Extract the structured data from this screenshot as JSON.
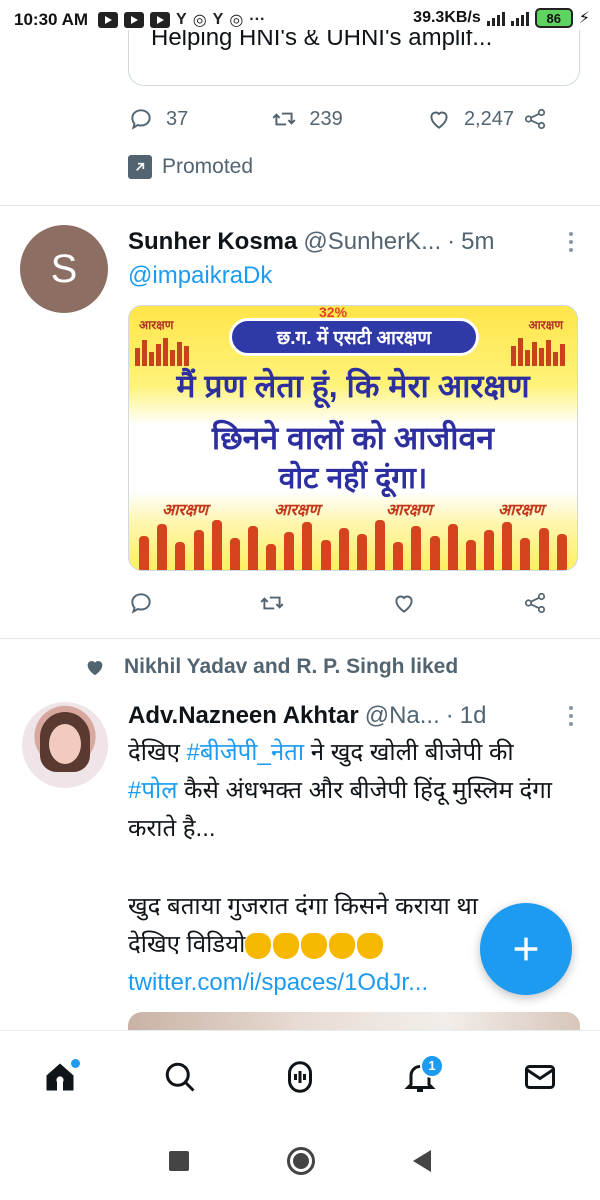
{
  "status_bar": {
    "time": "10:30 AM",
    "net_speed": "39.3KB/s",
    "battery": "86"
  },
  "promo_tweet": {
    "card_text": "Helping HNI's & UHNI's amplif...",
    "reply_count": "37",
    "retweet_count": "239",
    "like_count": "2,247",
    "promoted_label": "Promoted"
  },
  "tweet1": {
    "avatar_letter": "S",
    "name": "Sunher Kosma",
    "handle": "@SunherK...",
    "dot": "·",
    "time": "5m",
    "mention": "@impaikraDk",
    "banner": {
      "top_tag": "32%",
      "corner_label": "आरक्षण",
      "pill_text": "छ.ग. में एसटी आरक्षण",
      "line1": "मैं प्रण लेता हूं, कि मेरा आरक्षण",
      "line2": "छिनने वालों को आजीवन",
      "line3": "वोट नहीं दूंगा।",
      "bottom_labels": [
        "आरक्षण",
        "आरक्षण",
        "आरक्षण",
        "आरक्षण"
      ]
    }
  },
  "social_context": {
    "text": "Nikhil Yadav and R. P. Singh liked"
  },
  "tweet2": {
    "name": "Adv.Nazneen Akhtar",
    "handle": "@Na...",
    "dot": "·",
    "time": "1d",
    "text_part1": "देखिए ",
    "hashtag1": "#बीजेपी_नेता",
    "text_part2": " ने खुद खोली बीजेपी की",
    "hashtag2": "#पोल",
    "text_part3": " कैसे अंधभक्त और बीजेपी हिंदू मुस्लिम दंगा कराते है...",
    "text_part4": "खुद बताया गुजरात दंगा किसने कराया था",
    "text_part5": "देखिए विडियो",
    "link": "twitter.com/i/spaces/1OdJr..."
  },
  "bottom_nav": {
    "notification_count": "1"
  },
  "colors": {
    "accent": "#1d9bf0",
    "muted": "#536471",
    "text": "#0f1419"
  },
  "icons": [
    "reply-icon",
    "retweet-icon",
    "like-icon",
    "share-icon",
    "promoted-icon",
    "more-icon",
    "heart-filled-icon",
    "compose-plus-icon",
    "home-icon",
    "search-icon",
    "spaces-icon",
    "bell-icon",
    "mail-icon"
  ]
}
